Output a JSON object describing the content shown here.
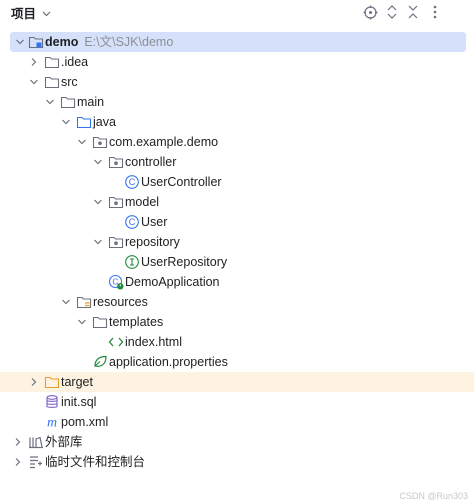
{
  "header": {
    "title": "项目",
    "tools": [
      "locate-icon",
      "expand-collapse-icon",
      "collapse-all-icon",
      "more-options-icon"
    ]
  },
  "tree": {
    "root": {
      "label": "demo",
      "path": "E:\\文\\SJK\\demo"
    },
    "idea": "idea",
    "src": "src",
    "main": "main",
    "java": "java",
    "package": "com.example.demo",
    "controller": "controller",
    "user_controller": "UserController",
    "model": "model",
    "user": "User",
    "repository": "repository",
    "user_repository": "UserRepository",
    "demo_application": "DemoApplication",
    "resources": "resources",
    "templates": "templates",
    "index_html": "index.html",
    "app_properties": "application.properties",
    "target": "target",
    "init_sql": "init.sql",
    "pom_xml": "pom.xml",
    "external_libs": "外部库",
    "scratches": "临时文件和控制台"
  },
  "colors": {
    "selection": "#d5e1fb",
    "excluded_highlight": "#fdf3e0",
    "class_icon": "#3574f0",
    "interface_icon": "#208a3c",
    "target_folder": "#e99b2c"
  },
  "watermark": "CSDN @Run303"
}
